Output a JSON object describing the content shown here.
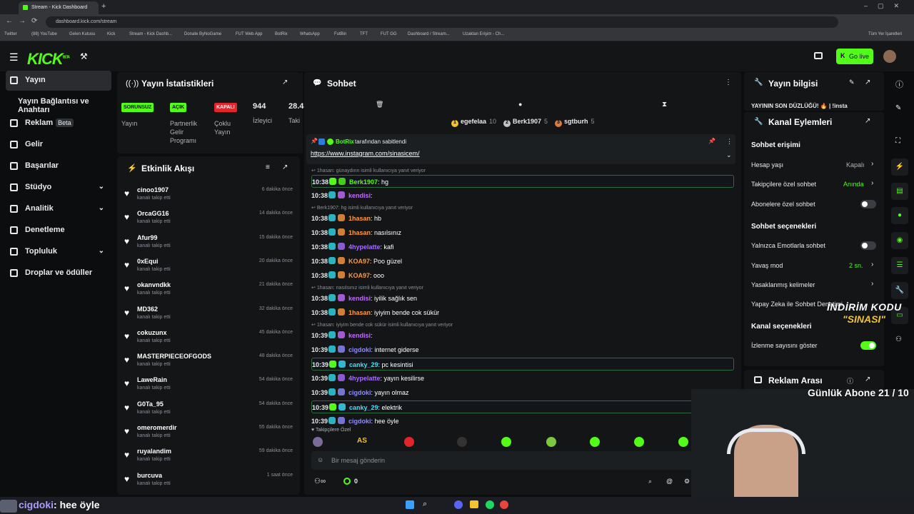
{
  "browser": {
    "tab_title": "Stream - Kick Dashboard",
    "url": "dashboard.kick.com/stream",
    "bookmarks": [
      "Twitter",
      "(88) YouTube",
      "Gelen Kutusu",
      "Kick",
      "Stream - Kick Dashb...",
      "Donate ByNoGame",
      "FUT Web App",
      "BotRix",
      "WhatsApp",
      "FutBin",
      "TFT",
      "FUT GG",
      "Dashboard / Stream...",
      "Uzaktan Erişim - Ch..."
    ],
    "bookmarks_all": "Tüm Yer İşaretleri"
  },
  "header": {
    "logo": "KICK",
    "logo_beta": "BETA",
    "go_live": "Go live"
  },
  "sidebar": {
    "items": [
      {
        "label": "Yayın"
      },
      {
        "label": "Yayın Bağlantısı ve Anahtarı"
      },
      {
        "label": "Reklam",
        "badge": "Beta"
      },
      {
        "label": "Gelir"
      },
      {
        "label": "Başarılar"
      },
      {
        "label": "Stüdyo"
      },
      {
        "label": "Analitik"
      },
      {
        "label": "Denetleme"
      },
      {
        "label": "Topluluk"
      },
      {
        "label": "Droplar ve ödüller"
      }
    ]
  },
  "stats": {
    "title": "Yayın İstatistikleri",
    "cards": [
      {
        "pill": "SORUNSUZ",
        "label": "Yayın"
      },
      {
        "pill": "AÇIK",
        "label": "Partnerlik Gelir Programı"
      },
      {
        "pill": "KAPALI",
        "label": "Çoklu Yayın"
      },
      {
        "value": "944",
        "label": "İzleyici"
      },
      {
        "value": "28.4",
        "label": "Taki"
      }
    ]
  },
  "feed": {
    "title": "Etkinlik Akışı",
    "sub": "kanalı takip etti",
    "items": [
      {
        "name": "cinoo1907",
        "time": "6 dakika önce"
      },
      {
        "name": "OrcaGG16",
        "time": "14 dakika önce"
      },
      {
        "name": "Afur99",
        "time": "15 dakika önce"
      },
      {
        "name": "0xEqui",
        "time": "20 dakika önce"
      },
      {
        "name": "okanvndkk",
        "time": "21 dakika önce"
      },
      {
        "name": "MD362",
        "time": "32 dakika önce"
      },
      {
        "name": "cokuzunx",
        "time": "45 dakika önce"
      },
      {
        "name": "MASTERPIECEOFGODS",
        "time": "48 dakika önce"
      },
      {
        "name": "LaweRain",
        "time": "54 dakika önce"
      },
      {
        "name": "G0Ta_95",
        "time": "54 dakika önce"
      },
      {
        "name": "omeromerdir",
        "time": "55 dakika önce"
      },
      {
        "name": "ruyalandim",
        "time": "59 dakika önce"
      },
      {
        "name": "burcuva",
        "time": "1 saat önce"
      }
    ]
  },
  "chat": {
    "title": "Sohbet",
    "top_users": [
      {
        "rank": "1",
        "name": "egefelaa",
        "count": "10"
      },
      {
        "rank": "2",
        "name": "Berk1907",
        "count": "5"
      },
      {
        "rank": "3",
        "name": "sgtburh",
        "count": "5"
      }
    ],
    "pinned_by": "BotRix",
    "pinned_suffix": "tarafından sabitlendi",
    "pinned_link": "https://www.instagram.com/sinasicem/",
    "lines": [
      {
        "reply": "1hasan: günaydınn isimli kullanıcıya yanıt veriyor",
        "time": "10:38",
        "user": "Berk1907",
        "color": "#53fc18",
        "text": ": hg",
        "hl": true
      },
      {
        "time": "10:38",
        "user": "kendisi",
        "color": "#c46bff",
        "text": ":"
      },
      {
        "reply": "Berk1907: hg isimli kullanıcıya yanıt veriyor",
        "time": "10:38",
        "user": "1hasan",
        "color": "#ff9a3c",
        "text": ": hb"
      },
      {
        "time": "10:38",
        "user": "1hasan",
        "color": "#ff9a3c",
        "text": ": nasılsınız"
      },
      {
        "time": "10:38",
        "user": "4hypelatte",
        "color": "#a86bff",
        "text": ": kafi"
      },
      {
        "time": "10:38",
        "user": "KOA97",
        "color": "#ff9a3c",
        "text": ": Poo güzel"
      },
      {
        "time": "10:38",
        "user": "KOA97",
        "color": "#ff9a3c",
        "text": ": ooo"
      },
      {
        "reply": "1hasan: nasılsınız isimli kullanıcıya yanıt veriyor",
        "time": "10:38",
        "user": "kendisi",
        "color": "#c46bff",
        "text": ": iyilik sağlık sen"
      },
      {
        "time": "10:38",
        "user": "1hasan",
        "color": "#ff9a3c",
        "text": ": iyiyim bende cok sükür"
      },
      {
        "reply": "1hasan: iyiyim bende cok sükür isimli kullanıcıya yanıt veriyor",
        "time": "10:39",
        "user": "kendisi",
        "color": "#c46bff",
        "text": ":"
      },
      {
        "time": "10:39",
        "user": "cigdoki",
        "color": "#8f8cff",
        "text": ": internet giderse"
      },
      {
        "time": "10:39",
        "user": "canky_29",
        "color": "#3ce0ff",
        "text": ": pc kesintisi",
        "hl": true
      },
      {
        "time": "10:39",
        "user": "4hypelatte",
        "color": "#a86bff",
        "text": ": yayın kesilirse"
      },
      {
        "time": "10:39",
        "user": "cigdoki",
        "color": "#8f8cff",
        "text": ": yayın olmaz"
      },
      {
        "time": "10:39",
        "user": "canky_29",
        "color": "#3ce0ff",
        "text": ": elektrik",
        "hl": true
      },
      {
        "time": "10:39",
        "user": "cigdoki",
        "color": "#8f8cff",
        "text": ": hee öyle"
      }
    ],
    "followers_only_label": "Takipçilere Özel",
    "emote_label": "AS",
    "input_placeholder": "Bir mesaj gönderin",
    "points": "0"
  },
  "stream_info": {
    "title": "Yayın bilgisi",
    "text": "YAYININ SON DÜZLÜĞÜ! 🔥 | !insta"
  },
  "channel_actions": {
    "title": "Kanal Eylemleri",
    "chat_access": "Sohbet erişimi",
    "account_age": "Hesap yaşı",
    "account_age_val": "Kapalı",
    "follower_chat": "Takipçilere özel sohbet",
    "follower_chat_val": "Anında",
    "sub_chat": "Abonelere özel sohbet",
    "chat_options": "Sohbet seçenekleri",
    "emote_only": "Yalnızca Emotlarla sohbet",
    "slow_mode": "Yavaş mod",
    "slow_mode_val": "2 sn.",
    "banned_words": "Yasaklanmış kelimeler",
    "ai_chat": "Yapay Zeka ile Sohbet Denetimi",
    "channel_options": "Kanal seçenekleri",
    "show_viewers": "İzlenme sayısını göster"
  },
  "ad_break": {
    "title": "Reklam Arası"
  },
  "overlay": {
    "promo_line1": "İNDİRİM KODU",
    "promo_line2": "\"SINASI\"",
    "daily_subs": "Günlük Abone 21 / 10",
    "last_msg_user": "cigdoki",
    "last_msg_text": ": hee öyle"
  },
  "colors": {
    "accent": "#53fc18",
    "bg": "#0b0d0e",
    "panel": "#141517"
  }
}
